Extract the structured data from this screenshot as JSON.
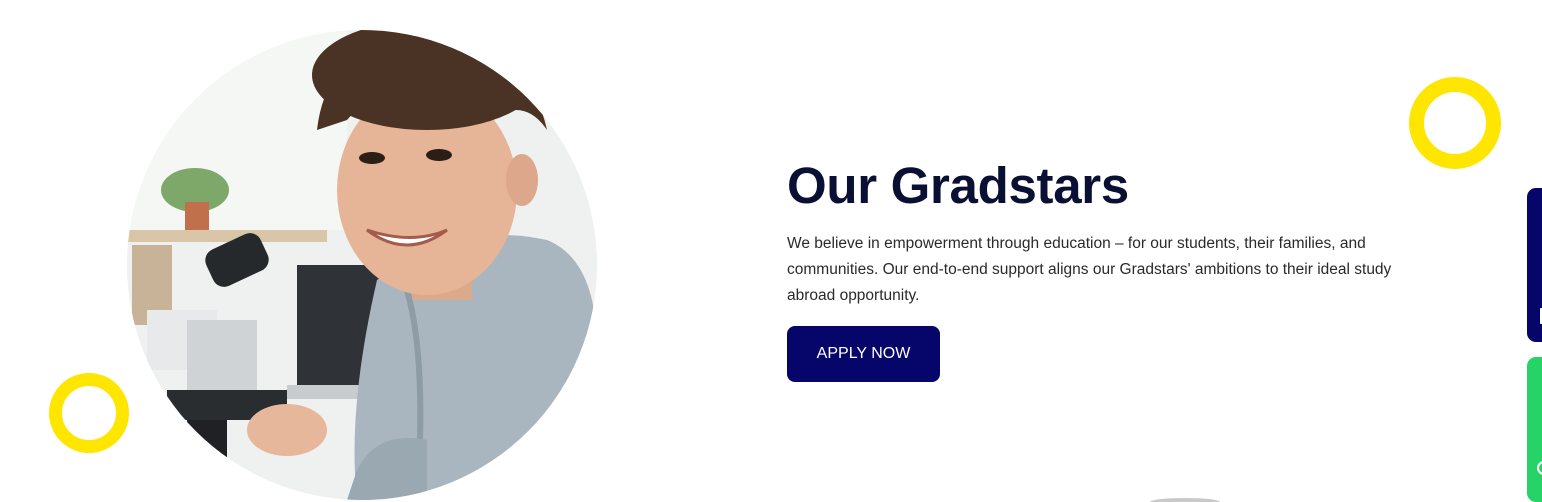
{
  "hero": {
    "heading": "Our Gradstars",
    "body": "We believe in empowerment through education – for our students, their families, and communities. Our end-to-end support aligns our Gradstars' ambitions to their ideal study abroad opportunity.",
    "cta_label": "APPLY NOW",
    "image_subject": "student-with-microscope-photo"
  },
  "decorations": {
    "ring_color": "#FFE600"
  },
  "side_widgets": {
    "top_color": "#06056A",
    "bottom_color": "#25D366",
    "top_icon": "panel-tab-icon",
    "bottom_icon": "chat-icon"
  },
  "colors": {
    "heading": "#0A1033",
    "button_bg": "#06056A",
    "button_text": "#FFFFFF"
  }
}
